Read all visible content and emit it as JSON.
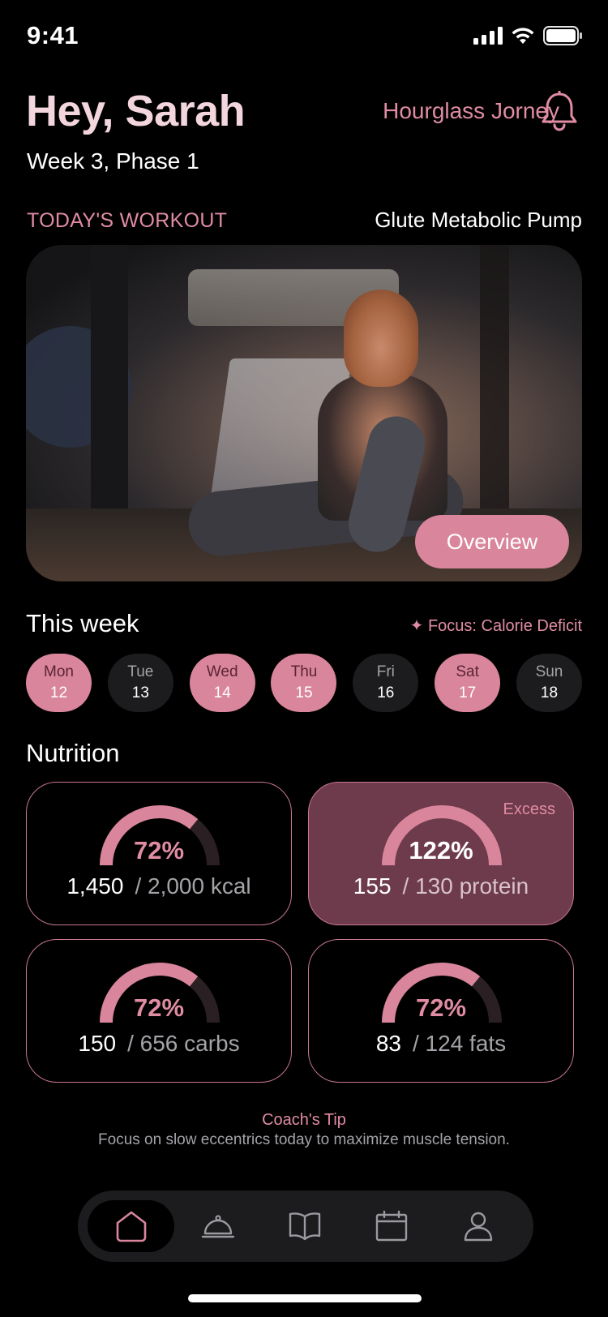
{
  "status": {
    "time": "9:41"
  },
  "header": {
    "greeting": "Hey, Sarah",
    "subtitle": "Week 3, Phase 1",
    "program": "Hourglass Jorney"
  },
  "workout": {
    "label": "TODAY'S WORKOUT",
    "name": "Glute Metabolic Pump",
    "button": "Overview"
  },
  "week": {
    "title": "This week",
    "focus": "✦ Focus: Calorie Deficit",
    "days": [
      {
        "name": "Mon",
        "date": "12",
        "active": true
      },
      {
        "name": "Tue",
        "date": "13",
        "active": false
      },
      {
        "name": "Wed",
        "date": "14",
        "active": true
      },
      {
        "name": "Thu",
        "date": "15",
        "active": true
      },
      {
        "name": "Fri",
        "date": "16",
        "active": false
      },
      {
        "name": "Sat",
        "date": "17",
        "active": true
      },
      {
        "name": "Sun",
        "date": "18",
        "active": false
      }
    ]
  },
  "nutrition": {
    "title": "Nutrition",
    "cards": [
      {
        "pct": "72%",
        "current": "1,450",
        "total": "/ 2,000 kcal",
        "progress": 0.72,
        "highlight": false,
        "tag": ""
      },
      {
        "pct": "122%",
        "current": "155",
        "total": "/ 130 protein",
        "progress": 1.0,
        "highlight": true,
        "tag": "Excess"
      },
      {
        "pct": "72%",
        "current": "150",
        "total": "/ 656 carbs",
        "progress": 0.72,
        "highlight": false,
        "tag": ""
      },
      {
        "pct": "72%",
        "current": "83",
        "total": "/ 124 fats",
        "progress": 0.72,
        "highlight": false,
        "tag": ""
      }
    ]
  },
  "coach": {
    "title": "Coach's Tip",
    "text": "Focus on slow eccentrics today to maximize muscle tension."
  },
  "nav": {
    "items": [
      "home-icon",
      "meal-cloche-icon",
      "book-icon",
      "calendar-icon",
      "profile-icon"
    ],
    "active_index": 0
  },
  "colors": {
    "accent": "#d9859c",
    "accent_text": "#e08ca3",
    "highlight_card": "#6e3b4c",
    "background": "#000000"
  }
}
